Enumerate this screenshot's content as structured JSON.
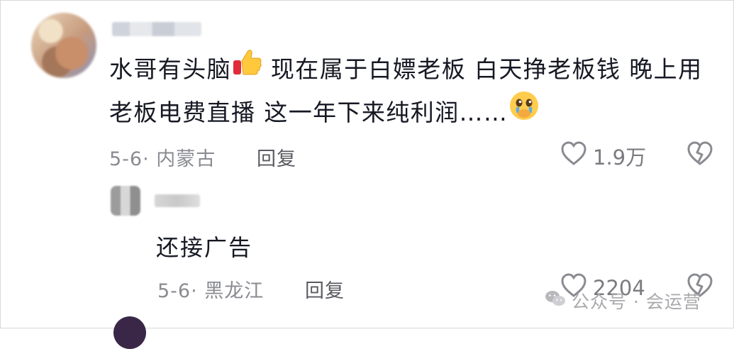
{
  "comment": {
    "text_part1": "水哥有头脑",
    "text_part2": " 现在属于白嫖老板  白天挣老板钱  晚上用老板电费直播  这一年下来纯利润……",
    "thumb_icon": "thumbs-up-emoji",
    "crying_icon": "pleading-crying-emoji",
    "date_location": "5-6· 内蒙古",
    "reply_label": "回复",
    "like_count": "1.9万",
    "like_icon": "heart-outline-icon",
    "dislike_icon": "broken-heart-icon"
  },
  "reply": {
    "text": "还接广告",
    "date_location": "5-6· 黑龙江",
    "reply_label": "回复",
    "like_count": "2204",
    "like_icon": "heart-outline-icon",
    "dislike_icon": "broken-heart-icon"
  },
  "watermark": {
    "text": "公众号 · 会运营",
    "icon": "wechat-icon"
  }
}
